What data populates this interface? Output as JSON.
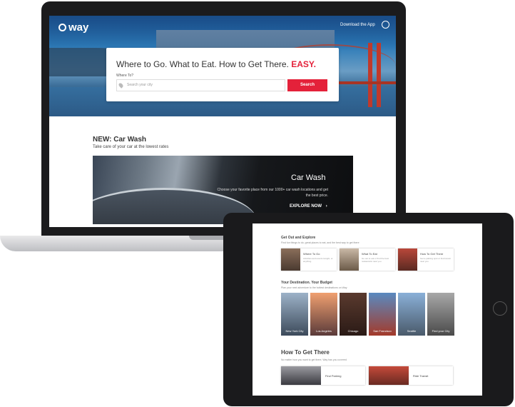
{
  "laptop": {
    "logo_text": "way",
    "download_link": "Download the App",
    "headline": "Where to Go. What to Eat. How to Get There.",
    "headline_accent": "EASY.",
    "where_label": "Where To?",
    "search_placeholder": "Search your city",
    "search_button": "Search",
    "section_title": "NEW: Car Wash",
    "section_subtitle": "Take care of your car at the lowest rates",
    "banner": {
      "title": "Car Wash",
      "description": "Choose your favorite place from our 1000+ car wash locations and get the best price.",
      "cta": "EXPLORE NOW"
    }
  },
  "tablet": {
    "explore": {
      "title": "Get Out and Explore",
      "subtitle": "Find fun things to do, great places to eat, and the best way to get there",
      "cards": [
        {
          "title": "Where To Go",
          "desc": "Activities and events tonight, or anything"
        },
        {
          "title": "What To Eat",
          "desc": "Go out to eat or find the best restaurants near you"
        },
        {
          "title": "How To Get There",
          "desc": "Get a parking spot or find transit near you"
        }
      ]
    },
    "destination": {
      "title": "Your Destination. Your Budget",
      "subtitle": "Plan your next adventure to the hottest destinations on Way",
      "cities": [
        "New York City",
        "Los Angeles",
        "Chicago",
        "San Francisco",
        "Seattle",
        "Find your City"
      ]
    },
    "get_there": {
      "title": "How To Get There",
      "subtitle": "No matter how you want to get there, Way has you covered",
      "cards": [
        "Find Parking",
        "Ride Transit"
      ]
    }
  },
  "colors": {
    "accent": "#e4213a",
    "hero_blue": "#2d7bb8"
  }
}
